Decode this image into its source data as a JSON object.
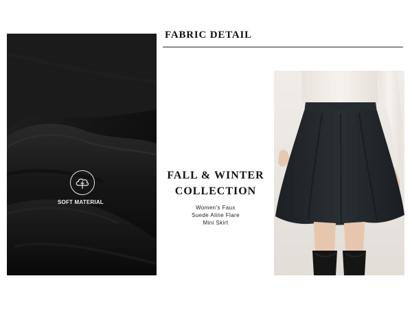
{
  "header": {
    "title": "FABRIC DETAIL"
  },
  "fabric_panel": {
    "badge_icon": "cloud-feather-icon",
    "badge_label": "SOFT MATERIAL",
    "fabric_color": "#141414"
  },
  "collection": {
    "line1": "FALL & WINTER",
    "line2": "COLLECTION"
  },
  "product": {
    "line1": "Women's Faux",
    "line2": "Suede Aline Flare",
    "line3": "Mini Skirt"
  },
  "model_photo": {
    "skirt_color": "#23272b",
    "top_color": "#f1ece6",
    "boots_color": "#151515"
  }
}
